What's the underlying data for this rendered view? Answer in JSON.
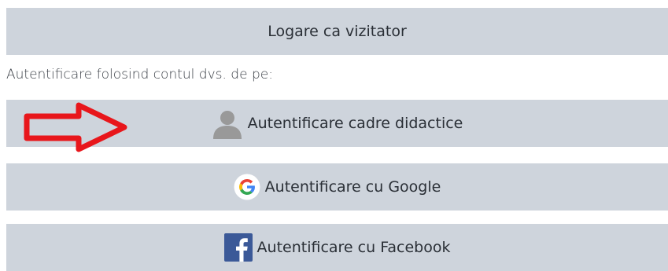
{
  "guest_login": {
    "label": "Logare ca vizitator"
  },
  "auth_section": {
    "title": "Autentificare folosind contul dvs. de pe:"
  },
  "auth_buttons": [
    {
      "label": "Autentificare cadre didactice",
      "icon": "user-icon"
    },
    {
      "label": "Autentificare cu Google",
      "icon": "google-icon"
    },
    {
      "label": "Autentificare cu Facebook",
      "icon": "facebook-icon"
    }
  ],
  "annotation": {
    "arrow_color": "#e8161b"
  },
  "colors": {
    "button_bg": "#ced4dc",
    "text": "#2a2f36",
    "google_blue": "#4285f4",
    "google_red": "#ea4335",
    "google_yellow": "#fbbc05",
    "google_green": "#34a853",
    "facebook_blue": "#3b5998",
    "user_icon": "#999999"
  }
}
